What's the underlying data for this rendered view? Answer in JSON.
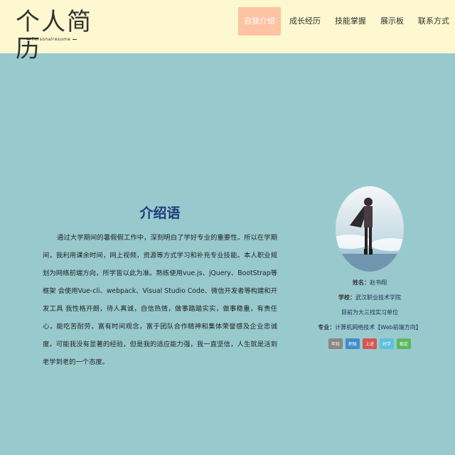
{
  "logo": {
    "title": "个人简历",
    "subtitle": "Personalresume"
  },
  "nav": {
    "items": [
      {
        "label": "自我介绍"
      },
      {
        "label": "成长经历"
      },
      {
        "label": "技能掌握"
      },
      {
        "label": "展示板"
      },
      {
        "label": "联系方式"
      }
    ]
  },
  "intro": {
    "title": "介绍语",
    "text": "通过大学期间的暑假假工作中，深刻明白了学好专业的重要性。所以在学期间，我利用课余时间，网上视频，资源等方式学习和补充专业技能。本人职业规划为网络前端方向，所学皆以此为准。熟练使用vue.js、jQuery、BootStrap等框架 会使用Vue-cli、webpack、Visual Studio Code、微信开发者等构建和开发工具 我性格开朗，待人真诚，自信热情，做事踏踏实实，做事稳重，有责任心，能吃苦耐劳，富有时间观念，富于团队合作精神和集体荣誉感及企业忠诚度。可能我没有显著的经验，但是我的适应能力强，我一直坚信，人生就是活到老学到老的一个态度。"
  },
  "profile": {
    "name_label": "姓名：",
    "name": "赵书翔",
    "school_label": "学校：",
    "school": "武汉职业技术学院",
    "internship": "目前为大三找实习单位",
    "major_label": "专业：",
    "major": "计算机网络技术【Web前端方向】"
  },
  "tags": [
    {
      "label": "年轻",
      "color": "#888888"
    },
    {
      "label": "积极",
      "color": "#428bca"
    },
    {
      "label": "上进",
      "color": "#d9534f"
    },
    {
      "label": "好学",
      "color": "#5bc0de"
    },
    {
      "label": "稳定",
      "color": "#5cb85c"
    }
  ],
  "colors": {
    "background": "#98cacd",
    "header": "#fdf8cf",
    "nav_active": "#fdc3a3",
    "title": "#1e3a7a"
  }
}
